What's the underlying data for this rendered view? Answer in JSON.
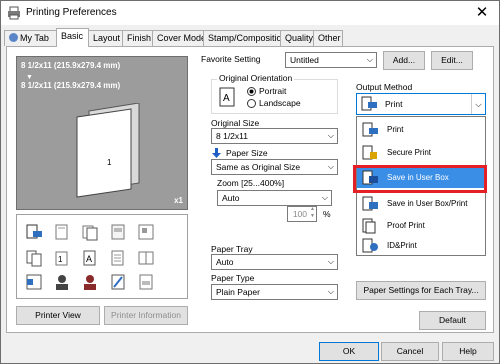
{
  "window": {
    "title": "Printing Preferences",
    "close_glyph": "✕"
  },
  "tabs": [
    "My Tab",
    "Basic",
    "Layout",
    "Finish",
    "Cover Mode",
    "Stamp/Composition",
    "Quality",
    "Other"
  ],
  "preview": {
    "line1": "8 1/2x11 (215.9x279.4 mm)",
    "line2": "8 1/2x11 (215.9x279.4 mm)",
    "copies": "x1"
  },
  "buttons": {
    "printer_view": "Printer View",
    "printer_information": "Printer Information",
    "add": "Add...",
    "edit": "Edit...",
    "paper_settings": "Paper Settings for Each Tray...",
    "default": "Default",
    "ok": "OK",
    "cancel": "Cancel",
    "help": "Help"
  },
  "favorite": {
    "label": "Favorite Setting",
    "value": "Untitled"
  },
  "orientation": {
    "label": "Original Orientation",
    "portrait": "Portrait",
    "landscape": "Landscape"
  },
  "original_size": {
    "label": "Original Size",
    "value": "8 1/2x11"
  },
  "paper_size": {
    "label": "Paper Size",
    "value": "Same as Original Size"
  },
  "zoom": {
    "label": "Zoom [25...400%]",
    "value": "Auto",
    "number": "100",
    "unit": "%"
  },
  "paper_tray": {
    "label": "Paper Tray",
    "value": "Auto"
  },
  "paper_type": {
    "label": "Paper Type",
    "value": "Plain Paper"
  },
  "output_method": {
    "label": "Output Method",
    "value": "Print",
    "options": [
      "Print",
      "Secure Print",
      "Save in User Box",
      "Save in User Box/Print",
      "Proof Print",
      "ID&Print"
    ],
    "selected_index": 2
  },
  "colors": {
    "highlight": "#3b8ee6",
    "callout": "#e41f26"
  }
}
